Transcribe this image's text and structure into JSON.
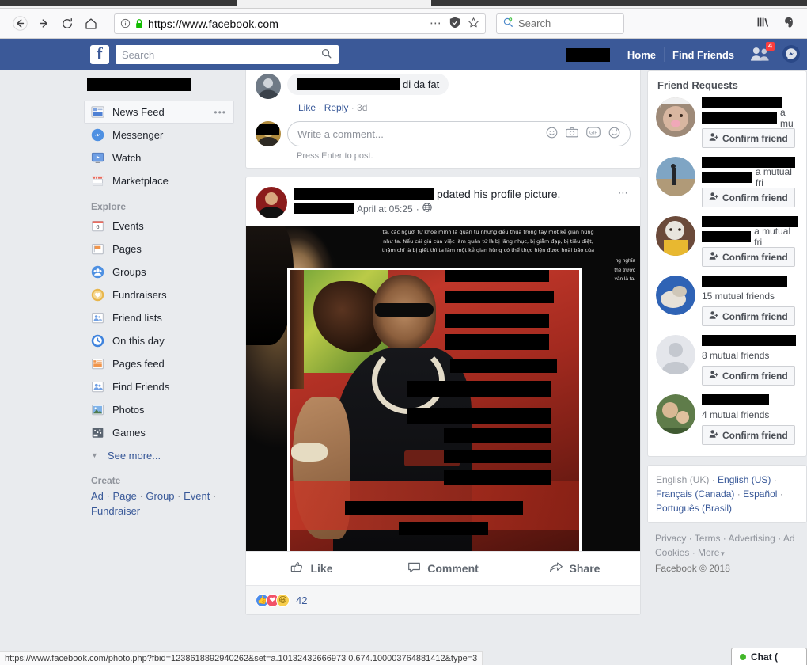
{
  "browser": {
    "back_label": "Back",
    "forward_label": "Forward",
    "reload_label": "Reload",
    "home_label": "Home",
    "url": "https://www.facebook.com",
    "identity_icon": "info-circle-icon",
    "lock_icon": "padlock-icon",
    "page_actions_icon": "ellipsis-icon",
    "container_icon": "shield-icon",
    "bookmark_icon": "star-icon",
    "search_placeholder": "Search",
    "search_icon": "magnifier-icon",
    "library_icon": "library-icon",
    "extension_icon": "evernote-elephant-icon",
    "status_url": "https://www.facebook.com/photo.php?fbid=1238618892940262&set=a.10132432666973 0.674.100003764881412&type=3"
  },
  "fbnav": {
    "logo_letter": "f",
    "search_placeholder": "Search",
    "search_icon": "magnifier-icon",
    "home_label": "Home",
    "find_friends_label": "Find Friends",
    "requests_icon": "friend-requests-icon",
    "requests_badge": "4",
    "messenger_icon": "messenger-icon",
    "account_name_redacted": ""
  },
  "sidebar": {
    "main_items": [
      {
        "label": "News Feed",
        "icon": "news-feed-icon",
        "active": true,
        "menu_dots": "•••"
      },
      {
        "label": "Messenger",
        "icon": "messenger-icon",
        "active": false
      },
      {
        "label": "Watch",
        "icon": "watch-icon",
        "active": false
      },
      {
        "label": "Marketplace",
        "icon": "marketplace-icon",
        "active": false
      }
    ],
    "explore_header": "Explore",
    "explore_items": [
      {
        "label": "Events",
        "icon": "calendar-icon",
        "badge": "6"
      },
      {
        "label": "Pages",
        "icon": "flag-icon"
      },
      {
        "label": "Groups",
        "icon": "groups-icon"
      },
      {
        "label": "Fundraisers",
        "icon": "heart-coin-icon"
      },
      {
        "label": "Friend lists",
        "icon": "friend-lists-icon"
      },
      {
        "label": "On this day",
        "icon": "clock-history-icon"
      },
      {
        "label": "Pages feed",
        "icon": "pages-feed-icon"
      },
      {
        "label": "Find Friends",
        "icon": "find-friends-icon"
      },
      {
        "label": "Photos",
        "icon": "photos-icon"
      },
      {
        "label": "Games",
        "icon": "games-icon"
      }
    ],
    "see_more_label": "See more...",
    "create_header": "Create",
    "create_links": [
      "Ad",
      "Page",
      "Group",
      "Event",
      "Fundraiser"
    ]
  },
  "feed": {
    "top_comment": {
      "text_tail": "di da fat",
      "like_label": "Like",
      "reply_label": "Reply",
      "time_label": "3d",
      "separator": "·"
    },
    "comment_box": {
      "placeholder": "Write a comment...",
      "hint": "Press Enter to post.",
      "tools": [
        "emoji-icon",
        "camera-icon",
        "gif-icon",
        "sticker-icon"
      ]
    },
    "post": {
      "headline_tail": "pdated his profile picture.",
      "date": "April at 05:25",
      "privacy_icon": "globe-icon",
      "menu_icon": "ellipsis-icon",
      "image_caption_lines": [
        "ta, các ngươi tự khoe mình là quân tử nhưng đều thua trong tay một kẻ gian hùng",
        "như ta. Nếu cái giá của việc làm quân tử là bị lăng nhục, bị giẫm đạp, bị tiêu diệt,",
        "thậm chí là bị giết thì ta làm một kẻ gian hùng có thể thực hiện được hoài bão của",
        "ng nghĩa",
        "thế trước",
        "vẫn là ta."
      ],
      "actions": [
        {
          "label": "Like",
          "icon": "thumbs-up-icon"
        },
        {
          "label": "Comment",
          "icon": "speech-bubble-icon"
        },
        {
          "label": "Share",
          "icon": "share-arrow-icon"
        }
      ],
      "reaction_count": "42",
      "reactions": [
        "like",
        "love",
        "haha"
      ]
    }
  },
  "friend_requests": {
    "title": "Friend Requests",
    "confirm_label": "Confirm friend",
    "confirm_icon": "add-friend-icon",
    "items": [
      {
        "mutual_text": "a mu",
        "name_redacted": true,
        "second_redact": true
      },
      {
        "mutual_text": "a mutual fri",
        "name_redacted": true,
        "second_redact": true
      },
      {
        "mutual_text": "a mutual fri",
        "name_redacted": true,
        "second_redact": true
      },
      {
        "mutual_text": "15 mutual friends",
        "name_redacted": true,
        "second_redact": false
      },
      {
        "mutual_text": "8 mutual friends",
        "name_redacted": true,
        "second_redact": false
      },
      {
        "mutual_text": "4 mutual friends",
        "name_redacted": true,
        "second_redact": false
      }
    ]
  },
  "locales": {
    "current": "English (UK)",
    "others": [
      "English (US)",
      "Français (Canada)",
      "Español",
      "Português (Brasil)"
    ],
    "separator": "·"
  },
  "footer": {
    "links": [
      "Privacy",
      "Terms",
      "Advertising",
      "Ad",
      "Cookies",
      "More"
    ],
    "copyright": "Facebook © 2018"
  },
  "chat": {
    "label": "Chat (",
    "status": "online"
  },
  "colors": {
    "fb_blue": "#3b5998",
    "page_bg": "#e9ebee",
    "link": "#385898",
    "badge_red": "#fa3e3e",
    "online_green": "#42b72a"
  }
}
